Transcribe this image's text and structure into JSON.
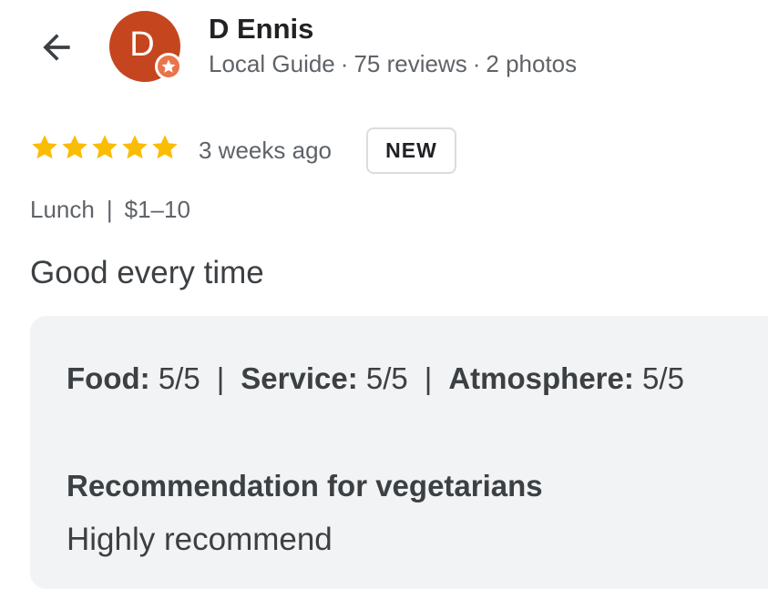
{
  "header": {
    "back_icon": "arrow-left-icon",
    "avatar": {
      "letter": "D",
      "color": "#c5461e",
      "badge_icon": "local-guide-star-icon",
      "badge_color": "#e8744b"
    },
    "user_name": "D Ennis",
    "user_level": "Local Guide",
    "reviews_count": "75 reviews",
    "photos_count": "2 photos",
    "separator": "·"
  },
  "review": {
    "rating": 5,
    "max_rating": 5,
    "star_color": "#fbbc04",
    "time_ago": "3 weeks ago",
    "badge": "NEW",
    "tags": [
      "Lunch",
      "$1–10"
    ],
    "tag_separator": "|",
    "text": "Good every time"
  },
  "details": {
    "ratings": [
      {
        "label": "Food",
        "value": "5/5"
      },
      {
        "label": "Service",
        "value": "5/5"
      },
      {
        "label": "Atmosphere",
        "value": "5/5"
      }
    ],
    "colon": ":",
    "separator": "|",
    "recommendation_label": "Recommendation for vegetarians",
    "recommendation_value": "Highly recommend"
  }
}
